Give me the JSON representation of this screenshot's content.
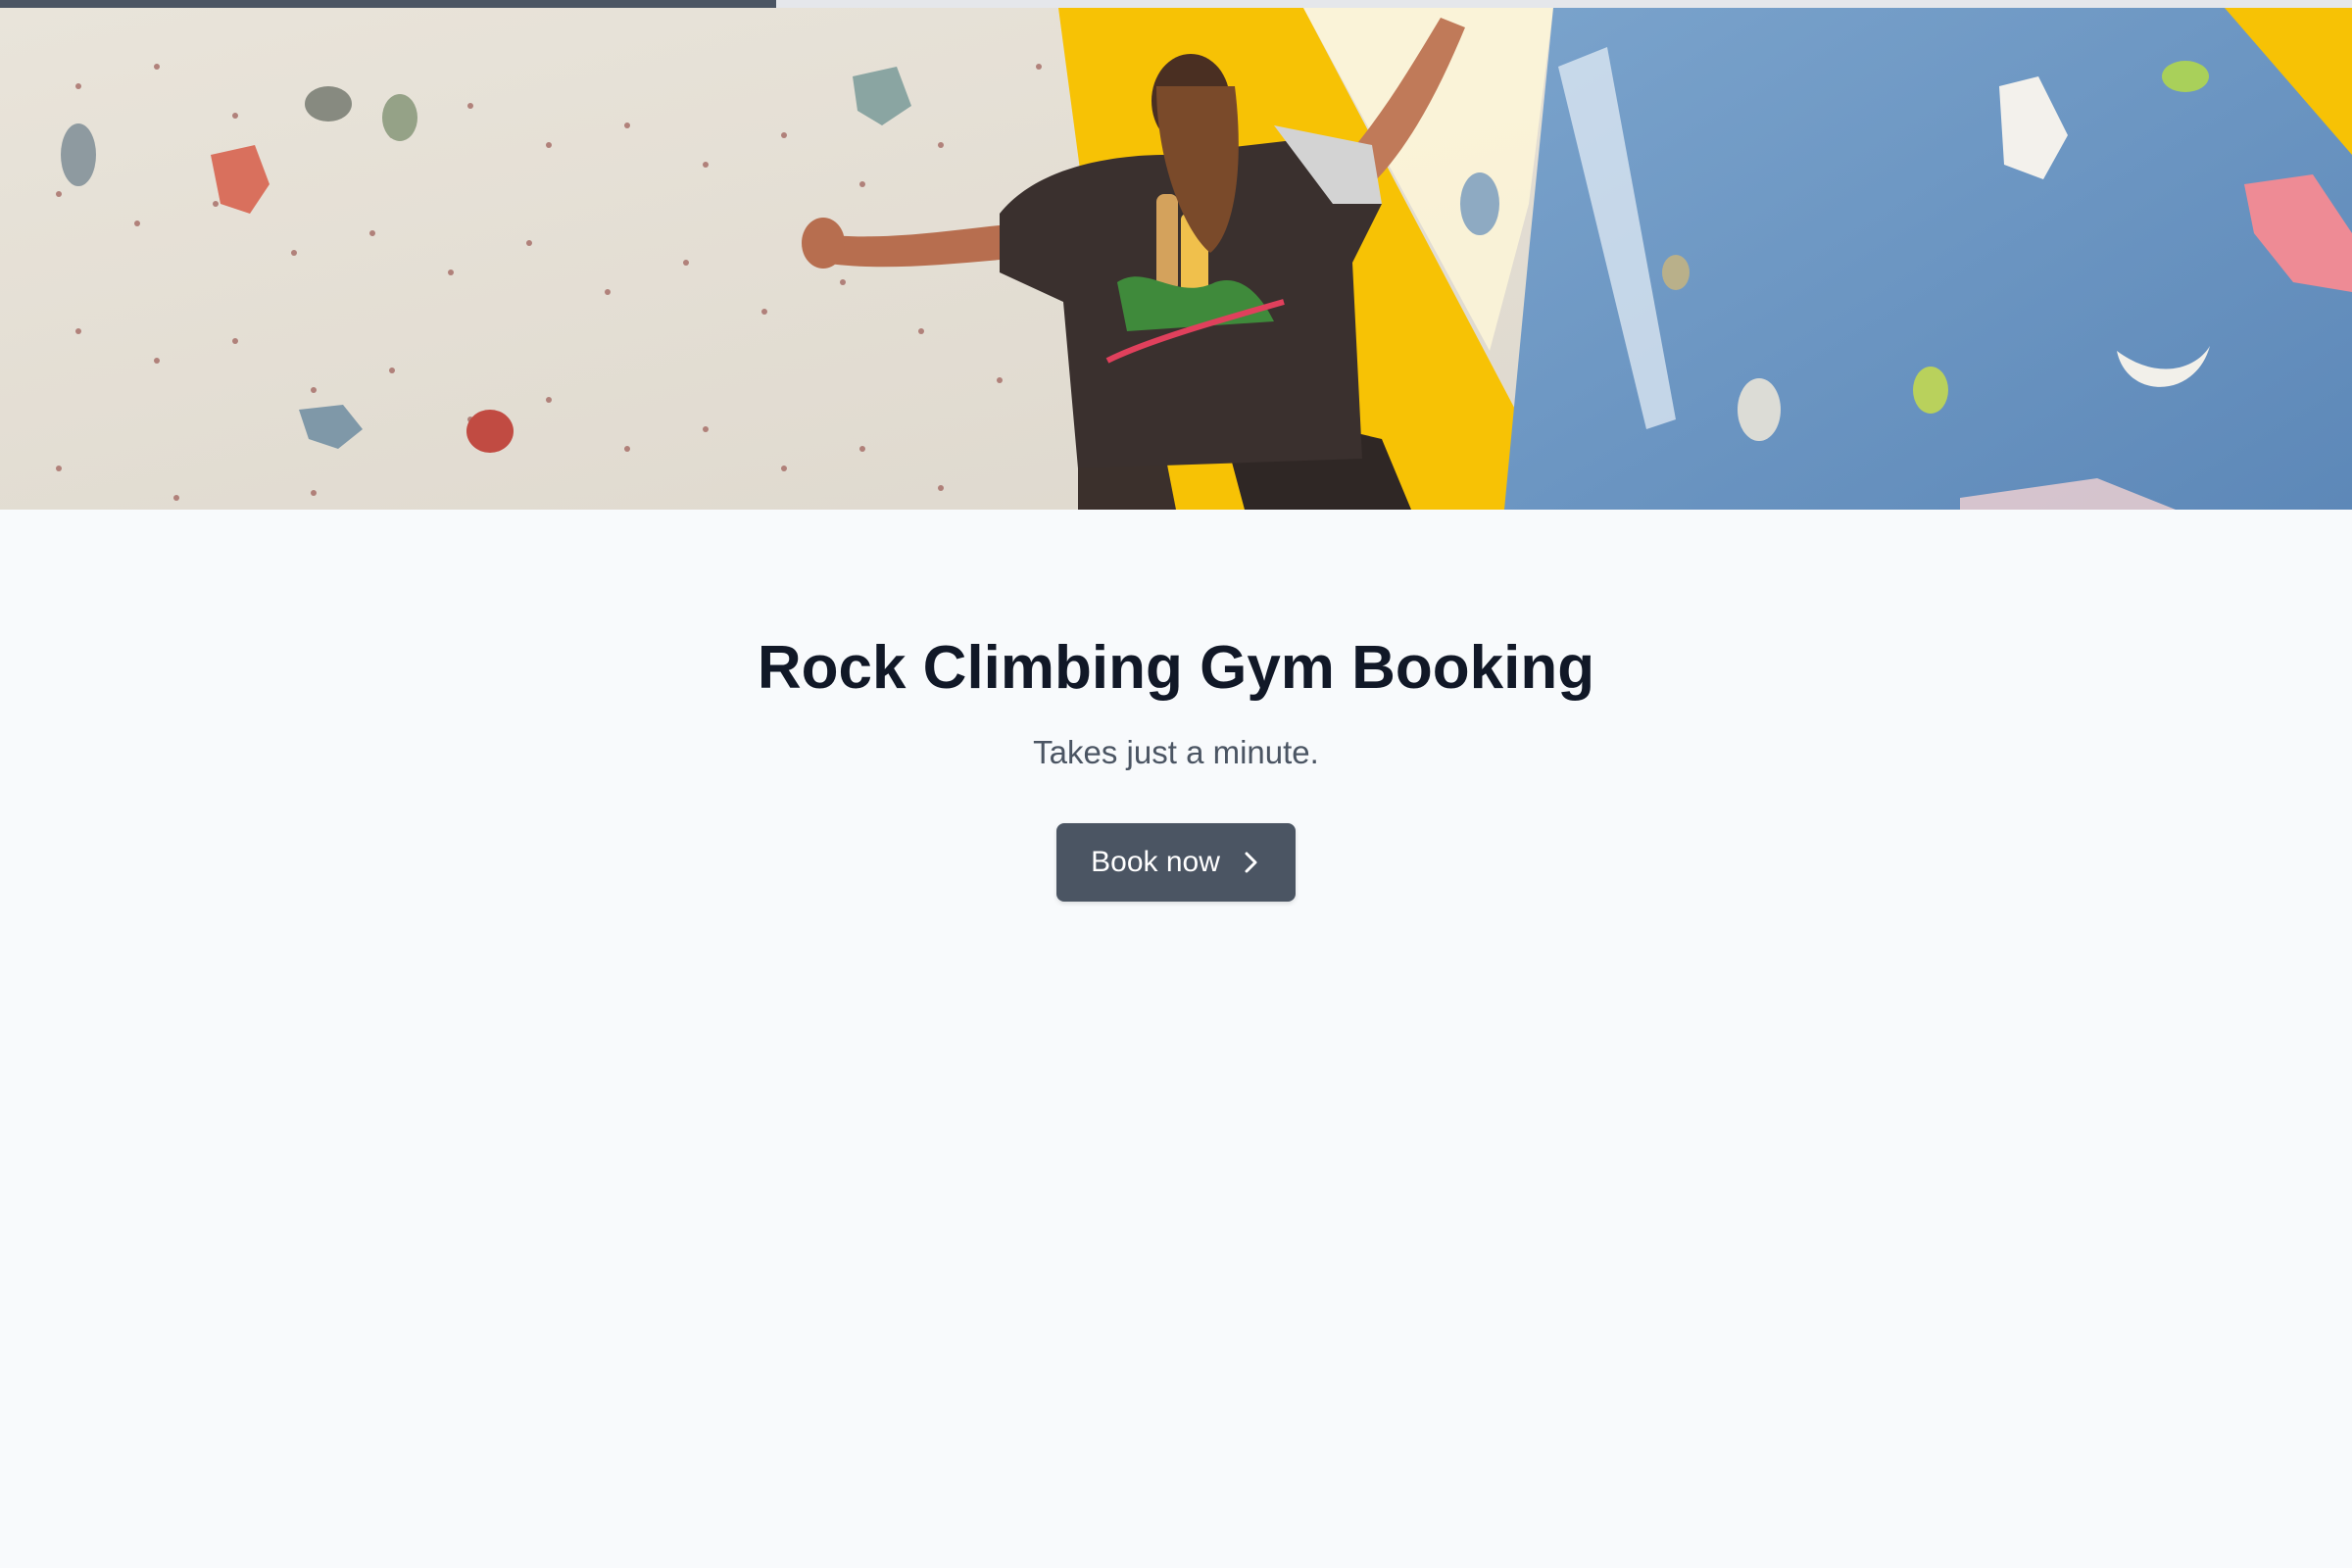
{
  "progress": {
    "fraction": 0.33,
    "track_color": "#e5e7eb",
    "fill_color": "#4b5563"
  },
  "hero": {
    "icon": "climbing-wall-photo",
    "description_colors": {
      "concrete": "#e7e1d6",
      "yellow": "#f6c000",
      "blue": "#6f98c4"
    }
  },
  "main": {
    "title": "Rock Climbing Gym Booking",
    "subtitle": "Takes just a minute.",
    "book_button_label": "Book now",
    "book_button_icon": "chevron-right-icon"
  },
  "colors": {
    "background": "#f8fafc",
    "title": "#111827",
    "subtitle": "#4b5563",
    "button": "#4b5563",
    "button_text": "#ffffff"
  }
}
